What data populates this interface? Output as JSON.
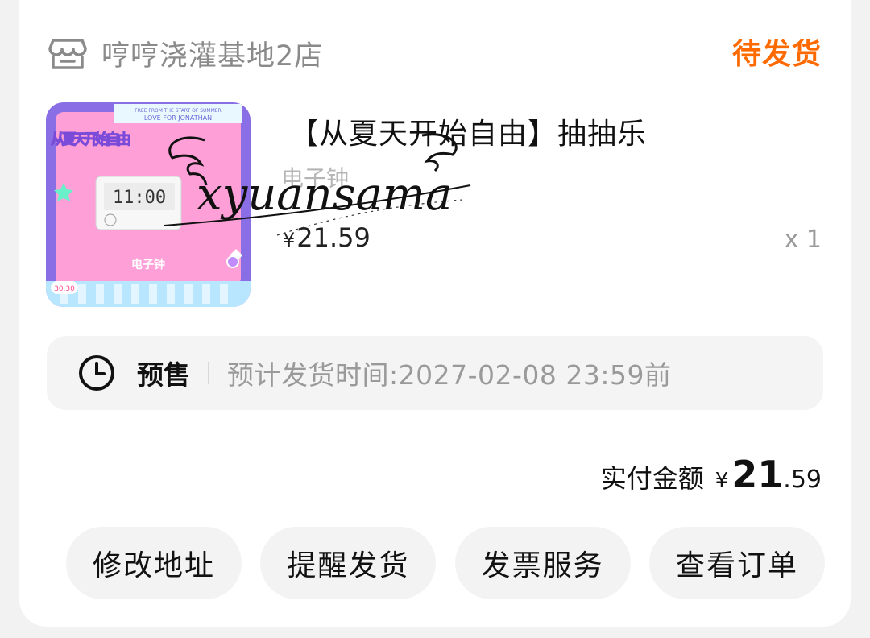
{
  "shop": {
    "name": "哼哼浇灌基地2店",
    "icon": "shop-icon"
  },
  "order": {
    "status": "待发货",
    "status_color": "#ff6a00"
  },
  "product": {
    "title": "【从夏天开始自由】抽抽乐",
    "sku": "电子钟",
    "price_currency": "¥",
    "price": "21.59",
    "qty": "x 1",
    "image": {
      "header_line1": "FREE FROM THE START OF SUMMER",
      "header_line2": "LOVE FOR JONATHAN",
      "corner_text": "从夏天开始自由",
      "caption": "电子钟",
      "clock_time": "11:00",
      "badge": "30.30"
    }
  },
  "watermark": {
    "text": "xyuansama"
  },
  "presale": {
    "icon": "clock-icon",
    "label": "预售",
    "text": "预计发货时间:2027-02-08 23:59前"
  },
  "total": {
    "label": "实付金额",
    "currency": "¥",
    "integer": "21",
    "decimal": ".59"
  },
  "actions": [
    {
      "label": "修改地址"
    },
    {
      "label": "提醒发货"
    },
    {
      "label": "发票服务"
    },
    {
      "label": "查看订单"
    }
  ]
}
